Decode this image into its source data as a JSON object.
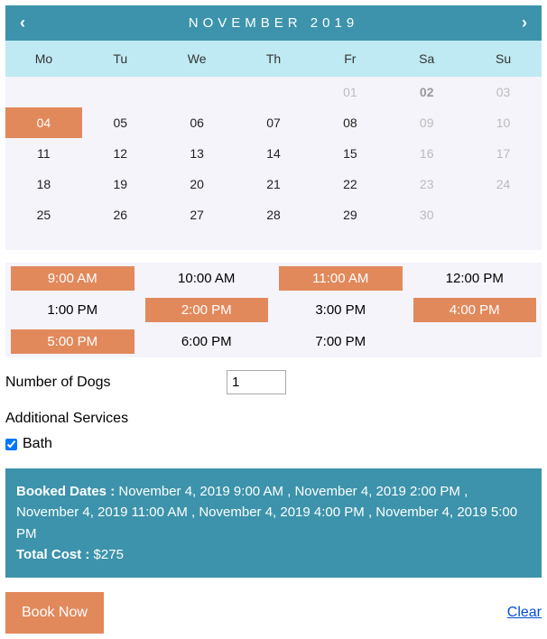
{
  "calendar": {
    "title": "NOVEMBER 2019",
    "dow": [
      "Mo",
      "Tu",
      "We",
      "Th",
      "Fr",
      "Sa",
      "Su"
    ],
    "weeks": [
      [
        {
          "n": "",
          "state": "empty"
        },
        {
          "n": "",
          "state": "empty"
        },
        {
          "n": "",
          "state": "empty"
        },
        {
          "n": "",
          "state": "empty"
        },
        {
          "n": "01",
          "state": "disabled"
        },
        {
          "n": "02",
          "state": "disabled-bold"
        },
        {
          "n": "03",
          "state": "disabled"
        }
      ],
      [
        {
          "n": "04",
          "state": "selected"
        },
        {
          "n": "05",
          "state": ""
        },
        {
          "n": "06",
          "state": ""
        },
        {
          "n": "07",
          "state": ""
        },
        {
          "n": "08",
          "state": ""
        },
        {
          "n": "09",
          "state": "disabled"
        },
        {
          "n": "10",
          "state": "disabled"
        }
      ],
      [
        {
          "n": "11",
          "state": ""
        },
        {
          "n": "12",
          "state": ""
        },
        {
          "n": "13",
          "state": ""
        },
        {
          "n": "14",
          "state": ""
        },
        {
          "n": "15",
          "state": ""
        },
        {
          "n": "16",
          "state": "disabled"
        },
        {
          "n": "17",
          "state": "disabled"
        }
      ],
      [
        {
          "n": "18",
          "state": ""
        },
        {
          "n": "19",
          "state": ""
        },
        {
          "n": "20",
          "state": ""
        },
        {
          "n": "21",
          "state": ""
        },
        {
          "n": "22",
          "state": ""
        },
        {
          "n": "23",
          "state": "disabled"
        },
        {
          "n": "24",
          "state": "disabled"
        }
      ],
      [
        {
          "n": "25",
          "state": ""
        },
        {
          "n": "26",
          "state": ""
        },
        {
          "n": "27",
          "state": ""
        },
        {
          "n": "28",
          "state": ""
        },
        {
          "n": "29",
          "state": ""
        },
        {
          "n": "30",
          "state": "disabled"
        },
        {
          "n": "",
          "state": "empty"
        }
      ]
    ]
  },
  "times": [
    {
      "label": "9:00 AM",
      "selected": true
    },
    {
      "label": "10:00 AM",
      "selected": false
    },
    {
      "label": "11:00 AM",
      "selected": true
    },
    {
      "label": "12:00 PM",
      "selected": false
    },
    {
      "label": "1:00 PM",
      "selected": false
    },
    {
      "label": "2:00 PM",
      "selected": true
    },
    {
      "label": "3:00 PM",
      "selected": false
    },
    {
      "label": "4:00 PM",
      "selected": true
    },
    {
      "label": "5:00 PM",
      "selected": true
    },
    {
      "label": "6:00 PM",
      "selected": false
    },
    {
      "label": "7:00 PM",
      "selected": false
    }
  ],
  "form": {
    "num_dogs_label": "Number of Dogs",
    "num_dogs_value": "1",
    "additional_services_label": "Additional Services",
    "bath_label": "Bath",
    "bath_checked": true
  },
  "summary": {
    "booked_label": "Booked Dates : ",
    "booked_value": "November 4, 2019 9:00 AM , November 4, 2019 2:00 PM , November 4, 2019 11:00 AM , November 4, 2019 4:00 PM , November 4, 2019 5:00 PM",
    "total_label": "Total Cost : ",
    "total_value": "$275"
  },
  "actions": {
    "book_label": "Book Now",
    "clear_label": "Clear"
  }
}
